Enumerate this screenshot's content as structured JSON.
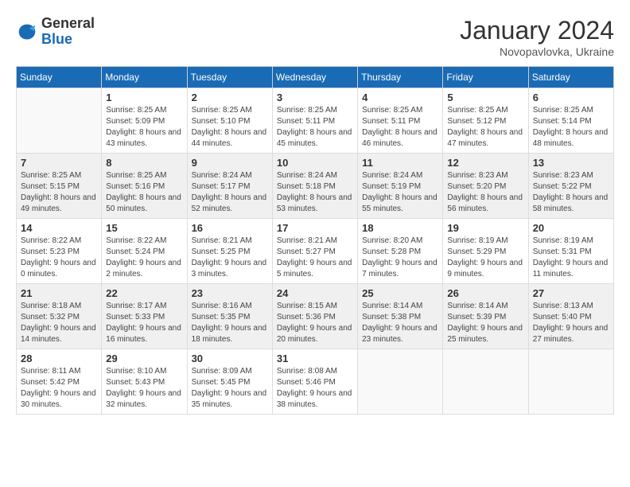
{
  "logo": {
    "general": "General",
    "blue": "Blue"
  },
  "title": {
    "month_year": "January 2024",
    "location": "Novopavlovka, Ukraine"
  },
  "weekdays": [
    "Sunday",
    "Monday",
    "Tuesday",
    "Wednesday",
    "Thursday",
    "Friday",
    "Saturday"
  ],
  "weeks": [
    [
      {
        "day": "",
        "sunrise": "",
        "sunset": "",
        "daylight": ""
      },
      {
        "day": "1",
        "sunrise": "Sunrise: 8:25 AM",
        "sunset": "Sunset: 5:09 PM",
        "daylight": "Daylight: 8 hours and 43 minutes."
      },
      {
        "day": "2",
        "sunrise": "Sunrise: 8:25 AM",
        "sunset": "Sunset: 5:10 PM",
        "daylight": "Daylight: 8 hours and 44 minutes."
      },
      {
        "day": "3",
        "sunrise": "Sunrise: 8:25 AM",
        "sunset": "Sunset: 5:11 PM",
        "daylight": "Daylight: 8 hours and 45 minutes."
      },
      {
        "day": "4",
        "sunrise": "Sunrise: 8:25 AM",
        "sunset": "Sunset: 5:11 PM",
        "daylight": "Daylight: 8 hours and 46 minutes."
      },
      {
        "day": "5",
        "sunrise": "Sunrise: 8:25 AM",
        "sunset": "Sunset: 5:12 PM",
        "daylight": "Daylight: 8 hours and 47 minutes."
      },
      {
        "day": "6",
        "sunrise": "Sunrise: 8:25 AM",
        "sunset": "Sunset: 5:14 PM",
        "daylight": "Daylight: 8 hours and 48 minutes."
      }
    ],
    [
      {
        "day": "7",
        "sunrise": "Sunrise: 8:25 AM",
        "sunset": "Sunset: 5:15 PM",
        "daylight": "Daylight: 8 hours and 49 minutes."
      },
      {
        "day": "8",
        "sunrise": "Sunrise: 8:25 AM",
        "sunset": "Sunset: 5:16 PM",
        "daylight": "Daylight: 8 hours and 50 minutes."
      },
      {
        "day": "9",
        "sunrise": "Sunrise: 8:24 AM",
        "sunset": "Sunset: 5:17 PM",
        "daylight": "Daylight: 8 hours and 52 minutes."
      },
      {
        "day": "10",
        "sunrise": "Sunrise: 8:24 AM",
        "sunset": "Sunset: 5:18 PM",
        "daylight": "Daylight: 8 hours and 53 minutes."
      },
      {
        "day": "11",
        "sunrise": "Sunrise: 8:24 AM",
        "sunset": "Sunset: 5:19 PM",
        "daylight": "Daylight: 8 hours and 55 minutes."
      },
      {
        "day": "12",
        "sunrise": "Sunrise: 8:23 AM",
        "sunset": "Sunset: 5:20 PM",
        "daylight": "Daylight: 8 hours and 56 minutes."
      },
      {
        "day": "13",
        "sunrise": "Sunrise: 8:23 AM",
        "sunset": "Sunset: 5:22 PM",
        "daylight": "Daylight: 8 hours and 58 minutes."
      }
    ],
    [
      {
        "day": "14",
        "sunrise": "Sunrise: 8:22 AM",
        "sunset": "Sunset: 5:23 PM",
        "daylight": "Daylight: 9 hours and 0 minutes."
      },
      {
        "day": "15",
        "sunrise": "Sunrise: 8:22 AM",
        "sunset": "Sunset: 5:24 PM",
        "daylight": "Daylight: 9 hours and 2 minutes."
      },
      {
        "day": "16",
        "sunrise": "Sunrise: 8:21 AM",
        "sunset": "Sunset: 5:25 PM",
        "daylight": "Daylight: 9 hours and 3 minutes."
      },
      {
        "day": "17",
        "sunrise": "Sunrise: 8:21 AM",
        "sunset": "Sunset: 5:27 PM",
        "daylight": "Daylight: 9 hours and 5 minutes."
      },
      {
        "day": "18",
        "sunrise": "Sunrise: 8:20 AM",
        "sunset": "Sunset: 5:28 PM",
        "daylight": "Daylight: 9 hours and 7 minutes."
      },
      {
        "day": "19",
        "sunrise": "Sunrise: 8:19 AM",
        "sunset": "Sunset: 5:29 PM",
        "daylight": "Daylight: 9 hours and 9 minutes."
      },
      {
        "day": "20",
        "sunrise": "Sunrise: 8:19 AM",
        "sunset": "Sunset: 5:31 PM",
        "daylight": "Daylight: 9 hours and 11 minutes."
      }
    ],
    [
      {
        "day": "21",
        "sunrise": "Sunrise: 8:18 AM",
        "sunset": "Sunset: 5:32 PM",
        "daylight": "Daylight: 9 hours and 14 minutes."
      },
      {
        "day": "22",
        "sunrise": "Sunrise: 8:17 AM",
        "sunset": "Sunset: 5:33 PM",
        "daylight": "Daylight: 9 hours and 16 minutes."
      },
      {
        "day": "23",
        "sunrise": "Sunrise: 8:16 AM",
        "sunset": "Sunset: 5:35 PM",
        "daylight": "Daylight: 9 hours and 18 minutes."
      },
      {
        "day": "24",
        "sunrise": "Sunrise: 8:15 AM",
        "sunset": "Sunset: 5:36 PM",
        "daylight": "Daylight: 9 hours and 20 minutes."
      },
      {
        "day": "25",
        "sunrise": "Sunrise: 8:14 AM",
        "sunset": "Sunset: 5:38 PM",
        "daylight": "Daylight: 9 hours and 23 minutes."
      },
      {
        "day": "26",
        "sunrise": "Sunrise: 8:14 AM",
        "sunset": "Sunset: 5:39 PM",
        "daylight": "Daylight: 9 hours and 25 minutes."
      },
      {
        "day": "27",
        "sunrise": "Sunrise: 8:13 AM",
        "sunset": "Sunset: 5:40 PM",
        "daylight": "Daylight: 9 hours and 27 minutes."
      }
    ],
    [
      {
        "day": "28",
        "sunrise": "Sunrise: 8:11 AM",
        "sunset": "Sunset: 5:42 PM",
        "daylight": "Daylight: 9 hours and 30 minutes."
      },
      {
        "day": "29",
        "sunrise": "Sunrise: 8:10 AM",
        "sunset": "Sunset: 5:43 PM",
        "daylight": "Daylight: 9 hours and 32 minutes."
      },
      {
        "day": "30",
        "sunrise": "Sunrise: 8:09 AM",
        "sunset": "Sunset: 5:45 PM",
        "daylight": "Daylight: 9 hours and 35 minutes."
      },
      {
        "day": "31",
        "sunrise": "Sunrise: 8:08 AM",
        "sunset": "Sunset: 5:46 PM",
        "daylight": "Daylight: 9 hours and 38 minutes."
      },
      {
        "day": "",
        "sunrise": "",
        "sunset": "",
        "daylight": ""
      },
      {
        "day": "",
        "sunrise": "",
        "sunset": "",
        "daylight": ""
      },
      {
        "day": "",
        "sunrise": "",
        "sunset": "",
        "daylight": ""
      }
    ]
  ]
}
